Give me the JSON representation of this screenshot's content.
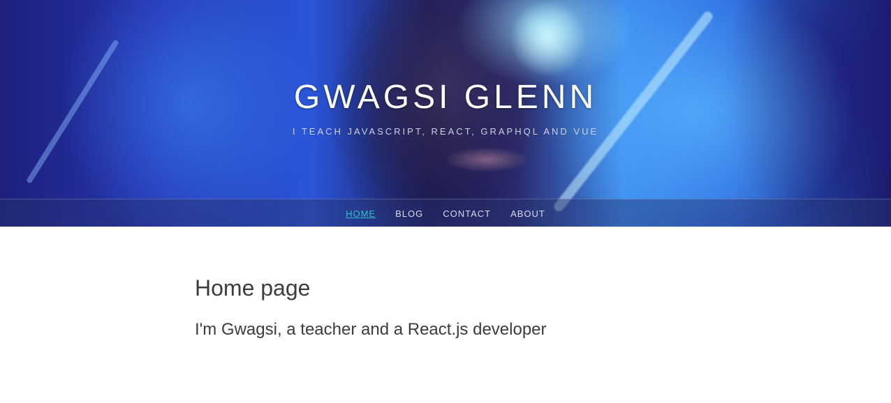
{
  "header": {
    "title": "GWAGSI GLENN",
    "tagline": "I TEACH JAVASCRIPT, REACT, GRAPHQL AND VUE"
  },
  "nav": {
    "items": [
      {
        "label": "HOME",
        "active": true
      },
      {
        "label": "BLOG",
        "active": false
      },
      {
        "label": "CONTACT",
        "active": false
      },
      {
        "label": "ABOUT",
        "active": false
      }
    ]
  },
  "main": {
    "heading": "Home page",
    "intro": "I'm Gwagsi, a teacher and a React.js developer"
  },
  "colors": {
    "active_link": "#2fc1c8",
    "text": "#3c3c3c",
    "hero_blue": "#2a55d8"
  }
}
